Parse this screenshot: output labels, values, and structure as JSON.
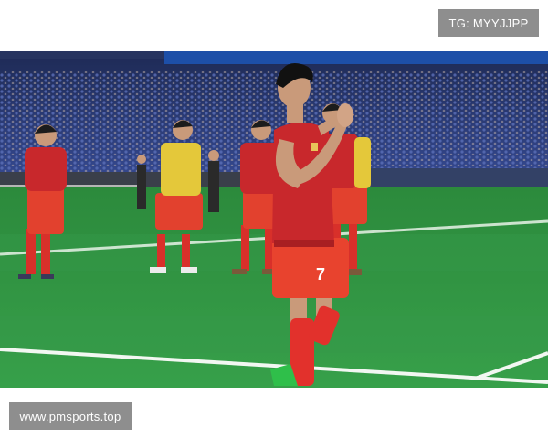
{
  "watermark_top": "TG: MYYJJPP",
  "watermark_bottom": "www.pmsports.top",
  "photo": {
    "subject": "footballer-applauding-fans",
    "jersey_number": "7",
    "kit_color": "#c8282c",
    "shorts_color": "#e8432e",
    "pitch_color": "#2f8f3f",
    "crowd_color": "#2d3f86"
  }
}
